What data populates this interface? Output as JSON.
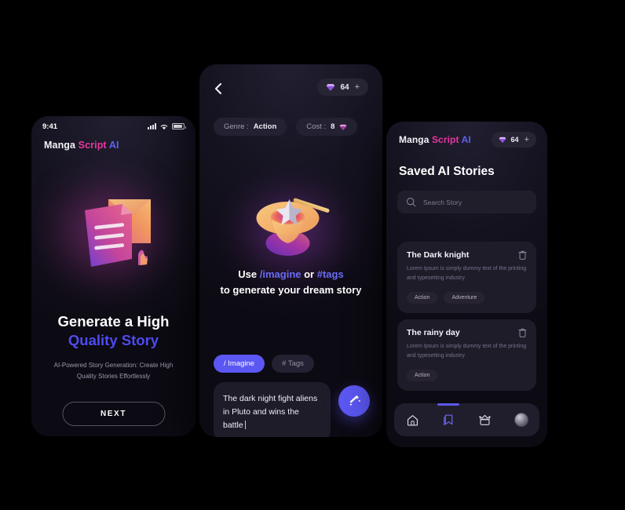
{
  "brand": {
    "part1": "Manga ",
    "part2": "Script ",
    "part3": "AI"
  },
  "colors": {
    "accent": "#5b57f2",
    "brand_pink": "#e8379f",
    "brand_blue": "#5b63f0",
    "card": "#1e1c29"
  },
  "phone1": {
    "status": {
      "time": "9:41",
      "signal_icon": "signal-bars-icon",
      "wifi_icon": "wifi-icon",
      "battery_icon": "battery-icon"
    },
    "hero_icon": "3d-document-illustration",
    "headline_line1": "Generate a High",
    "headline_line2": "Quality Story",
    "subtext": "AI-Powered Story Generation: Create High Quality Stories Effortlessly",
    "next_label": "NEXT"
  },
  "phone2": {
    "back_icon": "chevron-left-icon",
    "gems": {
      "icon": "gem-icon",
      "count": "64",
      "plus": "+"
    },
    "meta": [
      {
        "label": "Genre :",
        "value": "Action",
        "has_gem": false
      },
      {
        "label": "Cost :",
        "value": "8",
        "has_gem": true
      }
    ],
    "hero_icon": "3d-magic-hat-wand-illustration",
    "hint_prefix": "Use ",
    "hint_command": "/imagine",
    "hint_middle": " or ",
    "hint_tag": "#tags",
    "hint_line2": "to generate your dream story",
    "mode_chips": [
      {
        "label": "/ Imagine",
        "active": true
      },
      {
        "label": "# Tags",
        "active": false
      }
    ],
    "composer_text": "The dark night fight aliens in Pluto and wins the battle",
    "send_icon": "magic-wand-icon"
  },
  "phone3": {
    "gems": {
      "icon": "gem-icon",
      "count": "64",
      "plus": "+"
    },
    "page_title": "Saved AI Stories",
    "search": {
      "icon": "search-icon",
      "placeholder": "Search Story"
    },
    "cards": [
      {
        "title": "The Dark knight",
        "desc": "Lorem Ipsum is simply dummy text of the printing and typesetting industry",
        "delete_icon": "trash-icon",
        "tags": [
          "Action",
          "Adventure"
        ]
      },
      {
        "title": "The rainy day",
        "desc": "Lorem Ipsum is simply dummy text of the printing and typesetting industry",
        "delete_icon": "trash-icon",
        "tags": [
          "Action"
        ]
      }
    ],
    "tabs": [
      {
        "icon": "home-icon",
        "active": false
      },
      {
        "icon": "bookmark-icon",
        "active": true
      },
      {
        "icon": "crown-icon",
        "active": false
      },
      {
        "icon": "avatar-icon",
        "active": false
      }
    ]
  }
}
